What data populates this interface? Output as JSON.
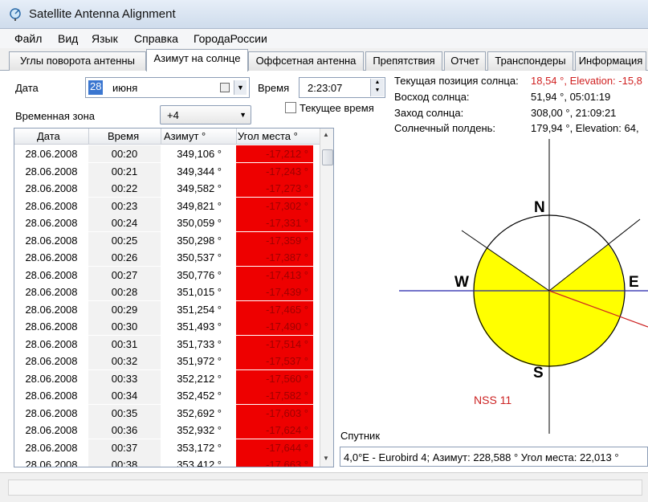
{
  "app": {
    "title": "Satellite Antenna Alignment"
  },
  "menu": [
    "Файл",
    "Вид",
    "Язык",
    "Справка",
    "ГородаРоссии"
  ],
  "tabs": [
    "Углы поворота антенны",
    "Азимут на солнце",
    "Оффсетная антенна",
    "Препятствия",
    "Отчет",
    "Транспондеры",
    "Информация"
  ],
  "active_tab": "Азимут на солнце",
  "form": {
    "date_label": "Дата",
    "date_day": "28",
    "date_month": "июня",
    "time_label": "Время",
    "time_value": "2:23:07",
    "tz_label": "Временная зона",
    "tz_value": "+4",
    "current_time_label": "Текущее время"
  },
  "table": {
    "headers": [
      "Дата",
      "Время",
      "Азимут °",
      "Угол места °"
    ],
    "rows": [
      [
        "28.06.2008",
        "00:20",
        "349,106 °",
        "-17,212 °"
      ],
      [
        "28.06.2008",
        "00:21",
        "349,344 °",
        "-17,243 °"
      ],
      [
        "28.06.2008",
        "00:22",
        "349,582 °",
        "-17,273 °"
      ],
      [
        "28.06.2008",
        "00:23",
        "349,821 °",
        "-17,302 °"
      ],
      [
        "28.06.2008",
        "00:24",
        "350,059 °",
        "-17,331 °"
      ],
      [
        "28.06.2008",
        "00:25",
        "350,298 °",
        "-17,359 °"
      ],
      [
        "28.06.2008",
        "00:26",
        "350,537 °",
        "-17,387 °"
      ],
      [
        "28.06.2008",
        "00:27",
        "350,776 °",
        "-17,413 °"
      ],
      [
        "28.06.2008",
        "00:28",
        "351,015 °",
        "-17,439 °"
      ],
      [
        "28.06.2008",
        "00:29",
        "351,254 °",
        "-17,465 °"
      ],
      [
        "28.06.2008",
        "00:30",
        "351,493 °",
        "-17,490 °"
      ],
      [
        "28.06.2008",
        "00:31",
        "351,733 °",
        "-17,514 °"
      ],
      [
        "28.06.2008",
        "00:32",
        "351,972 °",
        "-17,537 °"
      ],
      [
        "28.06.2008",
        "00:33",
        "352,212 °",
        "-17,560 °"
      ],
      [
        "28.06.2008",
        "00:34",
        "352,452 °",
        "-17,582 °"
      ],
      [
        "28.06.2008",
        "00:35",
        "352,692 °",
        "-17,603 °"
      ],
      [
        "28.06.2008",
        "00:36",
        "352,932 °",
        "-17,624 °"
      ],
      [
        "28.06.2008",
        "00:37",
        "353,172 °",
        "-17,644 °"
      ],
      [
        "28.06.2008",
        "00:38",
        "353,412 °",
        "-17,663 °"
      ]
    ]
  },
  "sun": {
    "current_label": "Текущая позиция солнца:",
    "current_value": "18,54 °, Elevation: -15,8",
    "sunrise_label": "Восход солнца:",
    "sunrise_value": "51,94 °, 05:01:19",
    "sunset_label": "Заход солнца:",
    "sunset_value": "308,00 °, 21:09:21",
    "noon_label": "Солнечный полдень:",
    "noon_value": "179,94 °, Elevation: 64,"
  },
  "compass": {
    "n": "N",
    "s": "S",
    "w": "W",
    "e": "E",
    "satellite": "NSS 11"
  },
  "satellite": {
    "label": "Спутник",
    "value": "4,0°E - Eurobird 4;  Азимут: 228,588 °  Угол места: 22,013 °"
  },
  "colors": {
    "sun_fill": "#ffff00",
    "below_horizon": "#ee0000",
    "sat_line": "#cc2222",
    "horizon_line": "#2222aa"
  }
}
